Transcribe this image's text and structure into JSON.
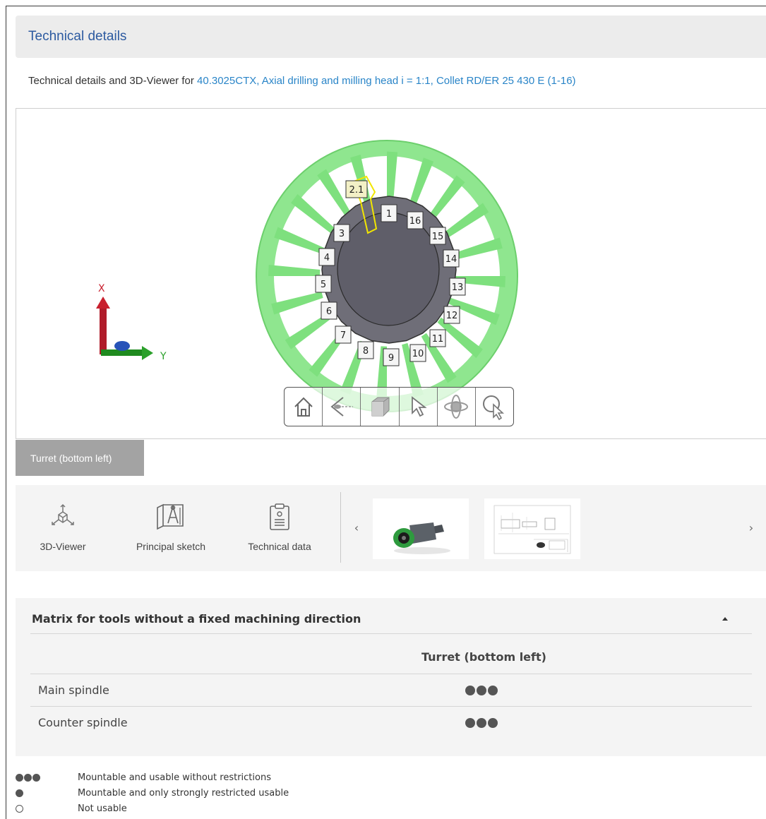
{
  "header": {
    "title": "Technical details"
  },
  "intro": {
    "prefix": "Technical details and 3D-Viewer for ",
    "link": "40.3025CTX, Axial drilling and milling head i = 1:1, Collet RD/ER 25 430 E (1-16)"
  },
  "viewer": {
    "axis_x": "X",
    "axis_y": "Y",
    "stations": [
      "2.1",
      "1",
      "16",
      "15",
      "14",
      "13",
      "12",
      "11",
      "10",
      "9",
      "8",
      "7",
      "6",
      "5",
      "4",
      "3"
    ],
    "toolbar": [
      "home-icon",
      "view-direction-icon",
      "cube-icon",
      "select-pointer-icon",
      "orbit-icon",
      "zoom-select-icon"
    ]
  },
  "tabs": {
    "turret": "Turret (bottom left)"
  },
  "media": {
    "items": [
      {
        "label": "3D-Viewer",
        "icon": "3d-axes-icon"
      },
      {
        "label": "Principal sketch",
        "icon": "sketch-icon"
      },
      {
        "label": "Technical data",
        "icon": "clipboard-icon"
      }
    ],
    "prev": "‹",
    "next": "›"
  },
  "matrix": {
    "title": "Matrix for tools without a fixed machining direction",
    "column": "Turret (bottom left)",
    "rows": [
      {
        "label": "Main spindle",
        "rating": 3
      },
      {
        "label": "Counter spindle",
        "rating": 3
      }
    ]
  },
  "legend": [
    {
      "symbol": "three-dots",
      "text": "Mountable and usable without restrictions"
    },
    {
      "symbol": "one-dot",
      "text": "Mountable and only strongly restricted usable"
    },
    {
      "symbol": "hollow-dot",
      "text": "Not usable"
    }
  ],
  "colors": {
    "accent": "#2c5aa0",
    "link": "#2a85c8",
    "turret_green": "#7be07b",
    "tab_gray": "#a3a3a3"
  }
}
